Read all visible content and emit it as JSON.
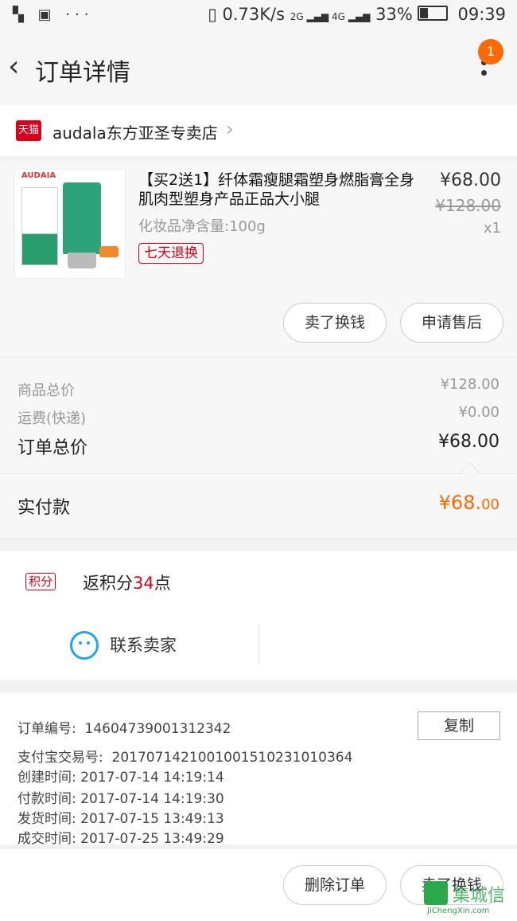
{
  "status_bar": {
    "left_icons": "▚ ▣ ···",
    "net_speed": "0.73K/s",
    "signal": "2G ▂▄▆ 4G ▂▄▆",
    "battery": "33%",
    "time": "09:39"
  },
  "header": {
    "title": "订单详情",
    "badge": "1"
  },
  "shop": {
    "platform_tag": "天猫",
    "name": "audala东方亚圣专卖店"
  },
  "product": {
    "image_brand": "AUDAIA",
    "name": "【买2送1】纤体霜瘦腿霜塑身燃脂膏全身肌肉型塑身产品正品大小腿",
    "spec": "化妆品净含量:100g",
    "service_tag": "七天退换",
    "price": "¥68.00",
    "original_price": "¥128.00",
    "quantity": "x1",
    "buttons": {
      "resell": "卖了换钱",
      "after_sales": "申请售后"
    }
  },
  "totals": {
    "goods_label": "商品总价",
    "goods_value": "¥128.00",
    "shipping_label": "运费(快递)",
    "shipping_value": "¥0.00",
    "order_label": "订单总价",
    "order_value": "¥68.00",
    "paid_label": "实付款",
    "paid_value_main": "¥68.",
    "paid_value_cents": "00"
  },
  "points": {
    "tag": "积分",
    "prefix": "返积分",
    "number": "34",
    "suffix": "点"
  },
  "contact": {
    "label": "联系卖家"
  },
  "order_info": {
    "order_no_label": "订单编号:",
    "order_no": "14604739001312342",
    "copy_label": "复制",
    "alipay_label": "支付宝交易号:",
    "alipay_no": "2017071421001001510231010364",
    "created_label": "创建时间:",
    "created": "2017-07-14 14:19:14",
    "paid_label": "付款时间:",
    "paid": "2017-07-14 14:19:30",
    "shipped_label": "发货时间:",
    "shipped": "2017-07-15 13:49:13",
    "closed_label": "成交时间:",
    "closed": "2017-07-25 13:49:29"
  },
  "bottom_bar": {
    "delete_label": "删除订单",
    "resell_label": "卖了换钱"
  },
  "watermark": {
    "text": "集城信",
    "url": "JiChengXin.com"
  },
  "colors": {
    "accent_red": "#d9001b",
    "accent_orange": "#ff6a00",
    "contact_blue": "#27a4e8"
  }
}
